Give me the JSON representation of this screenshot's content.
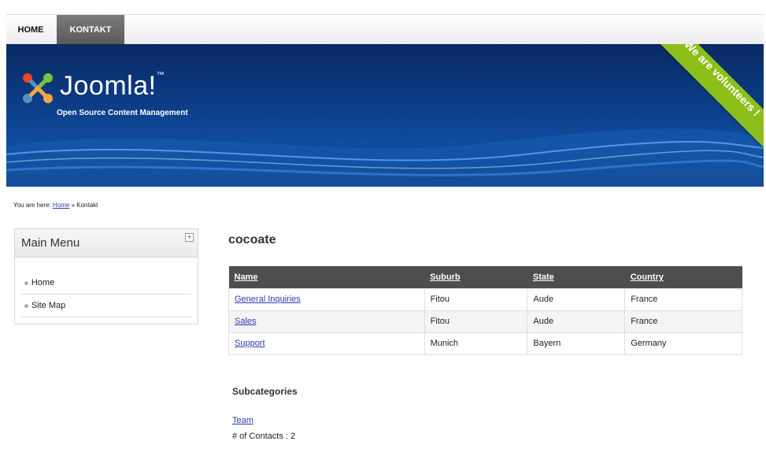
{
  "nav": {
    "tabs": [
      {
        "label": "HOME",
        "active": false
      },
      {
        "label": "KONTAKT",
        "active": true
      }
    ]
  },
  "header": {
    "logo_text": "Joomla!",
    "logo_tm": "™",
    "tagline": "Open Source Content Management",
    "ribbon_text": "We are volunteers !",
    "ribbon_color": "#8dbf1a"
  },
  "breadcrumb": {
    "prefix": "You are here:",
    "home": "Home",
    "separator": "»",
    "current": "Kontakt"
  },
  "sidebar": {
    "title": "Main Menu",
    "toggle": "+",
    "items": [
      {
        "label": "Home"
      },
      {
        "label": "Site Map"
      }
    ]
  },
  "main": {
    "title": "cocoate",
    "table": {
      "headers": [
        "Name",
        "Suburb",
        "State",
        "Country"
      ],
      "rows": [
        [
          "General Inquiries",
          "Fitou",
          "Aude",
          "France"
        ],
        [
          "Sales",
          "Fitou",
          "Aude",
          "France"
        ],
        [
          "Support",
          "Munich",
          "Bayern",
          "Germany"
        ]
      ]
    },
    "subcategories": {
      "title": "Subcategories",
      "link": "Team",
      "count_text": "# of Contacts : 2"
    }
  },
  "colors": {
    "link": "#2b3bb0",
    "header_bg": "#0c3c84",
    "table_header_bg": "#4e4e4e",
    "active_tab_bg": "#5a5a5a"
  }
}
